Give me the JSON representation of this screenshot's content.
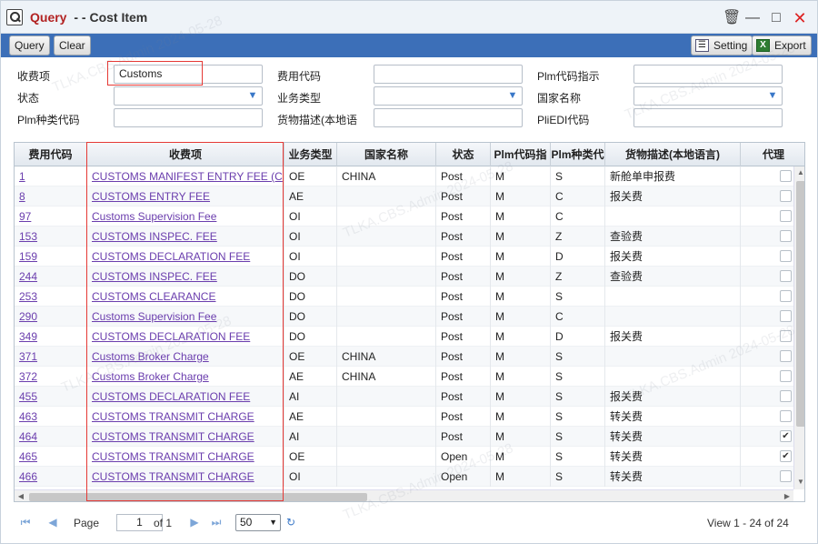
{
  "window": {
    "title_main": "Query",
    "title_sep": "- - Cost Item"
  },
  "toolbar": {
    "query_label": "Query",
    "clear_label": "Clear",
    "setting_label": "Setting",
    "export_label": "Export"
  },
  "filters": {
    "fee_item": {
      "label": "收费项",
      "value": "Customs"
    },
    "fee_code": {
      "label": "费用代码",
      "value": ""
    },
    "plm_code_indicator": {
      "label": "Plm代码指示",
      "value": ""
    },
    "status": {
      "label": "状态",
      "value": ""
    },
    "business_type": {
      "label": "业务类型",
      "value": ""
    },
    "country_name": {
      "label": "国家名称",
      "value": ""
    },
    "plm_type_code": {
      "label": "Plm种类代码",
      "value": ""
    },
    "goods_desc": {
      "label": "货物描述(本地语",
      "value": ""
    },
    "pli_edi_code": {
      "label": "PliEDI代码",
      "value": ""
    }
  },
  "grid": {
    "columns": [
      "费用代码",
      "收费项",
      "业务类型",
      "国家名称",
      "状态",
      "Plm代码指",
      "Plm种类代",
      "货物描述(本地语言)",
      "代理"
    ],
    "rows": [
      {
        "code": "1",
        "item": "CUSTOMS MANIFEST ENTRY FEE (C",
        "btype": "OE",
        "country": "CHINA",
        "status": "Post",
        "plm": "M",
        "plmtype": "S",
        "desc": "新舱单申报费",
        "agent": false
      },
      {
        "code": "8",
        "item": "CUSTOMS ENTRY FEE",
        "btype": "AE",
        "country": "",
        "status": "Post",
        "plm": "M",
        "plmtype": "C",
        "desc": "报关费",
        "agent": false
      },
      {
        "code": "97",
        "item": "Customs Supervision Fee",
        "btype": "OI",
        "country": "",
        "status": "Post",
        "plm": "M",
        "plmtype": "C",
        "desc": "",
        "agent": false
      },
      {
        "code": "153",
        "item": "CUSTOMS INSPEC. FEE",
        "btype": "OI",
        "country": "",
        "status": "Post",
        "plm": "M",
        "plmtype": "Z",
        "desc": "查验费",
        "agent": false
      },
      {
        "code": "159",
        "item": "CUSTOMS DECLARATION FEE",
        "btype": "OI",
        "country": "",
        "status": "Post",
        "plm": "M",
        "plmtype": "D",
        "desc": "报关费",
        "agent": false
      },
      {
        "code": "244",
        "item": "CUSTOMS INSPEC. FEE",
        "btype": "DO",
        "country": "",
        "status": "Post",
        "plm": "M",
        "plmtype": "Z",
        "desc": "查验费",
        "agent": false
      },
      {
        "code": "253",
        "item": "CUSTOMS CLEARANCE",
        "btype": "DO",
        "country": "",
        "status": "Post",
        "plm": "M",
        "plmtype": "S",
        "desc": "",
        "agent": false
      },
      {
        "code": "290",
        "item": "Customs Supervision Fee",
        "btype": "DO",
        "country": "",
        "status": "Post",
        "plm": "M",
        "plmtype": "C",
        "desc": "",
        "agent": false
      },
      {
        "code": "349",
        "item": "CUSTOMS DECLARATION FEE",
        "btype": "DO",
        "country": "",
        "status": "Post",
        "plm": "M",
        "plmtype": "D",
        "desc": "报关费",
        "agent": false
      },
      {
        "code": "371",
        "item": "Customs Broker Charge",
        "btype": "OE",
        "country": "CHINA",
        "status": "Post",
        "plm": "M",
        "plmtype": "S",
        "desc": "",
        "agent": false
      },
      {
        "code": "372",
        "item": "Customs Broker Charge",
        "btype": "AE",
        "country": "CHINA",
        "status": "Post",
        "plm": "M",
        "plmtype": "S",
        "desc": "",
        "agent": false
      },
      {
        "code": "455",
        "item": "CUSTOMS DECLARATION FEE",
        "btype": "AI",
        "country": "",
        "status": "Post",
        "plm": "M",
        "plmtype": "S",
        "desc": "报关费",
        "agent": false
      },
      {
        "code": "463",
        "item": "CUSTOMS TRANSMIT CHARGE",
        "btype": "AE",
        "country": "",
        "status": "Post",
        "plm": "M",
        "plmtype": "S",
        "desc": "转关费",
        "agent": false
      },
      {
        "code": "464",
        "item": "CUSTOMS TRANSMIT CHARGE",
        "btype": "AI",
        "country": "",
        "status": "Post",
        "plm": "M",
        "plmtype": "S",
        "desc": "转关费",
        "agent": true
      },
      {
        "code": "465",
        "item": "CUSTOMS TRANSMIT CHARGE",
        "btype": "OE",
        "country": "",
        "status": "Open",
        "plm": "M",
        "plmtype": "S",
        "desc": "转关费",
        "agent": true
      },
      {
        "code": "466",
        "item": "CUSTOMS TRANSMIT CHARGE",
        "btype": "OI",
        "country": "",
        "status": "Open",
        "plm": "M",
        "plmtype": "S",
        "desc": "转关费",
        "agent": false
      }
    ]
  },
  "pager": {
    "page_label": "Page",
    "page_value": "1",
    "of_label": "of 1",
    "page_size": "50",
    "view_text": "View 1 - 24 of 24"
  },
  "watermark_text": "TLKA.CBS.Admin 2024-05-28"
}
